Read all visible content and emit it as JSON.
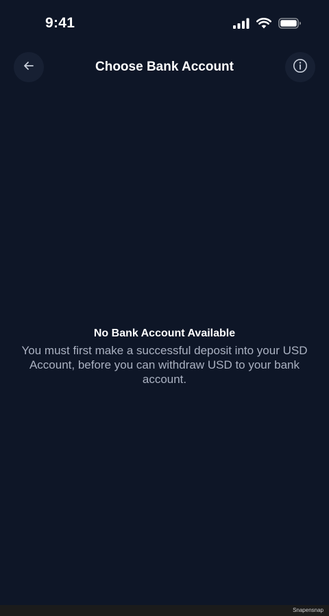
{
  "status_bar": {
    "time": "9:41",
    "icons": [
      "cellular-signal-icon",
      "wifi-icon",
      "battery-icon"
    ]
  },
  "header": {
    "title": "Choose Bank Account",
    "back_icon": "arrow-left-icon",
    "info_icon": "info-circle-icon"
  },
  "empty_state": {
    "title": "No Bank Account Available",
    "message": "You must first make a successful deposit into your USD Account, before you can withdraw USD to your bank account."
  },
  "watermark": "Snapensnap",
  "colors": {
    "background": "#0e1627",
    "button_bg": "#172033",
    "muted_text": "#aab1c1"
  }
}
